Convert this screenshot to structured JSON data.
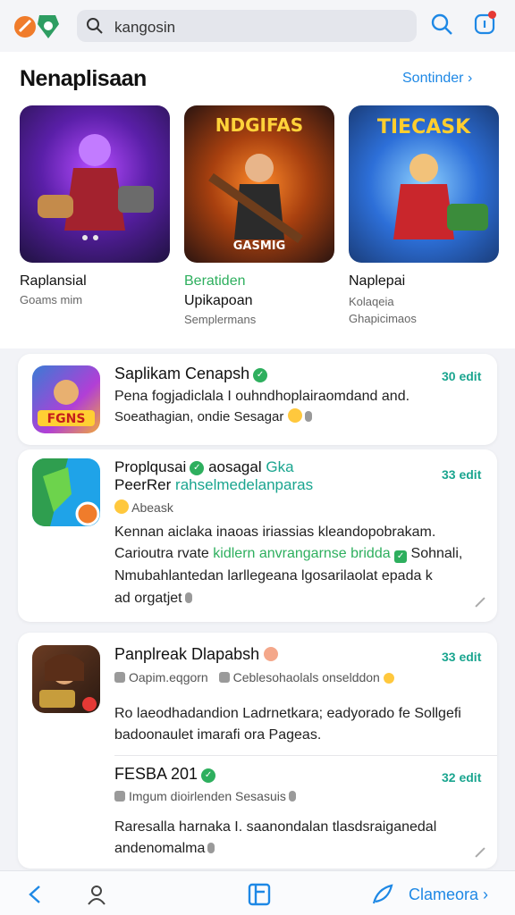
{
  "header": {
    "search_value": "kangosin",
    "icons": {
      "logo": "app-logo",
      "search": "search-icon",
      "notify": "bell-icon"
    }
  },
  "featured": {
    "title": "Nenaplisaan",
    "see_all": "Sontinder",
    "cards": [
      {
        "thumb_title": "",
        "name": "Raplansial",
        "line2": "",
        "line3": "Goams mim"
      },
      {
        "thumb_title": "NDGIFAS",
        "thumb_caption": "GASMIG",
        "name": "Beratiden",
        "line2": "Upikapoan",
        "line3": "Semplermans"
      },
      {
        "thumb_title": "TIECASK",
        "name": "Naplepai",
        "line2": "Kolaqeia",
        "line3": "Ghapicimaos"
      }
    ]
  },
  "list": [
    {
      "icon_title": "FGNS",
      "title": "Saplikam Cenapsh",
      "size": "30 edit",
      "line1": "Pena fogjadiclala I ouhndhoplairaomdand and.",
      "line2": "Soeathagian, ondie Sesagar"
    },
    {
      "title_a": "Proplqusai",
      "title_b": "aosagal",
      "title_link": "Gka",
      "title2": "PeerRer",
      "title2_link": "rahselmedelanparas",
      "sub": "Abeask",
      "size": "33 edit",
      "line1": "Kennan aiclaka inaoas iriassias kleandopobrakam.",
      "line2a": "Carioutra rvate",
      "line2_link": "kidlern anvrangarnse bridda",
      "line2b": "Sohnali,",
      "line3": "Nmubahlantedan larllegeana lgosarilaolat epada k",
      "line4": "ad orgatjet"
    },
    {
      "title": "Panplreak Dlapabsh",
      "size": "33 edit",
      "meta1": "Oapim.eqgorn",
      "meta2": "Ceblesohaolals onselddon",
      "line1": "Ro laeodhadandion Ladrnetkara; eadyorado fe Sollgefi",
      "line2": "badoonaulet imarafi ora Pageas."
    },
    {
      "title": "FESBA 201",
      "size": "32 edit",
      "meta": "Imgum dioirlenden Sesasuis",
      "line1": "Raresalla harnaka I. saanondalan tlasdsraiganedal",
      "line2": "andenomalma"
    }
  ],
  "bottom_nav": {
    "label": "Clameora",
    "icons": [
      "back-icon",
      "profile-icon",
      "book-icon",
      "feather-icon"
    ]
  },
  "colors": {
    "accent": "#1e88e5",
    "green": "#2eaf5e",
    "teal": "#1aa58f"
  }
}
